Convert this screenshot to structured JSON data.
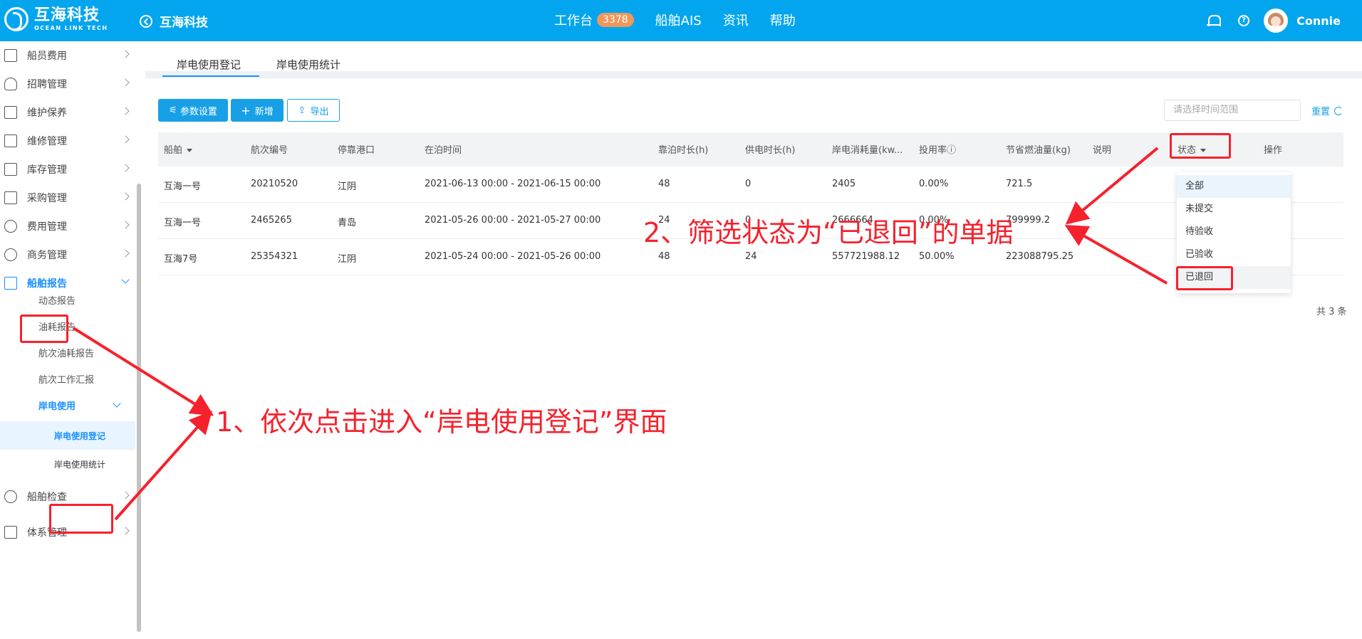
{
  "header": {
    "logo_cn": "互海科技",
    "logo_en": "OCEAN LINK TECH",
    "back_title": "互海科技",
    "nav": [
      {
        "label": "工作台",
        "badge": "3378"
      },
      {
        "label": "船舶AIS"
      },
      {
        "label": "资讯"
      },
      {
        "label": "帮助"
      }
    ],
    "help_glyph": "?",
    "username": "Connie",
    "color": "#03a6ee"
  },
  "sidebar": {
    "items": [
      {
        "label": "船员费用",
        "icon": "wallet-icon"
      },
      {
        "label": "招聘管理",
        "icon": "user-icon"
      },
      {
        "label": "维护保养",
        "icon": "hammer-icon"
      },
      {
        "label": "维修管理",
        "icon": "wrench-icon"
      },
      {
        "label": "库存管理",
        "icon": "home-icon"
      },
      {
        "label": "采购管理",
        "icon": "cart-icon"
      },
      {
        "label": "费用管理",
        "icon": "database-icon"
      },
      {
        "label": "商务管理",
        "icon": "globe-icon"
      },
      {
        "label": "船舶报告",
        "icon": "calendar-icon"
      }
    ],
    "sub": [
      "动态报告",
      "油耗报告",
      "航次油耗报告",
      "航次工作汇报",
      "岸电使用"
    ],
    "leaves": [
      "岸电使用登记",
      "岸电使用统计"
    ],
    "bottom": [
      {
        "label": "船舶检查",
        "icon": "check-circle-icon"
      },
      {
        "label": "体系管理",
        "icon": "document-icon"
      }
    ]
  },
  "tabs": [
    "岸电使用登记",
    "岸电使用统计"
  ],
  "toolbar": {
    "params_label": "参数设置",
    "add_label": "新增",
    "export_label": "导出",
    "date_placeholder": "请选择时间范围",
    "reset_label": "重置"
  },
  "table": {
    "headers": [
      "船舶",
      "航次编号",
      "停靠港口",
      "在泊时间",
      "靠泊时长(h)",
      "供电时长(h)",
      "岸电消耗量(kw...",
      "投用率ⓘ",
      "节省燃油量(kg)",
      "说明",
      "状态",
      "操作"
    ],
    "rows": [
      [
        "互海一号",
        "20210520",
        "江阴",
        "2021-06-13 00:00 - 2021-06-15 00:00",
        "48",
        "0",
        "2405",
        "0.00%",
        "721.5"
      ],
      [
        "互海一号",
        "2465265",
        "青岛",
        "2021-05-26 00:00 - 2021-05-27 00:00",
        "24",
        "0",
        "2666664",
        "0.00%",
        "799999.2"
      ],
      [
        "互海7号",
        "25354321",
        "江阴",
        "2021-05-24 00:00 - 2021-05-26 00:00",
        "48",
        "24",
        "557721988.12",
        "50.00%",
        "223088795.25"
      ]
    ],
    "total": "共 3 条"
  },
  "status_dropdown": [
    "全部",
    "未提交",
    "待验收",
    "已验收",
    "已退回"
  ],
  "annotations": {
    "step1": "1、依次点击进入“岸电使用登记”界面",
    "step2": "2、筛选状态为“已退回”的单据",
    "color": "#f5222d"
  }
}
